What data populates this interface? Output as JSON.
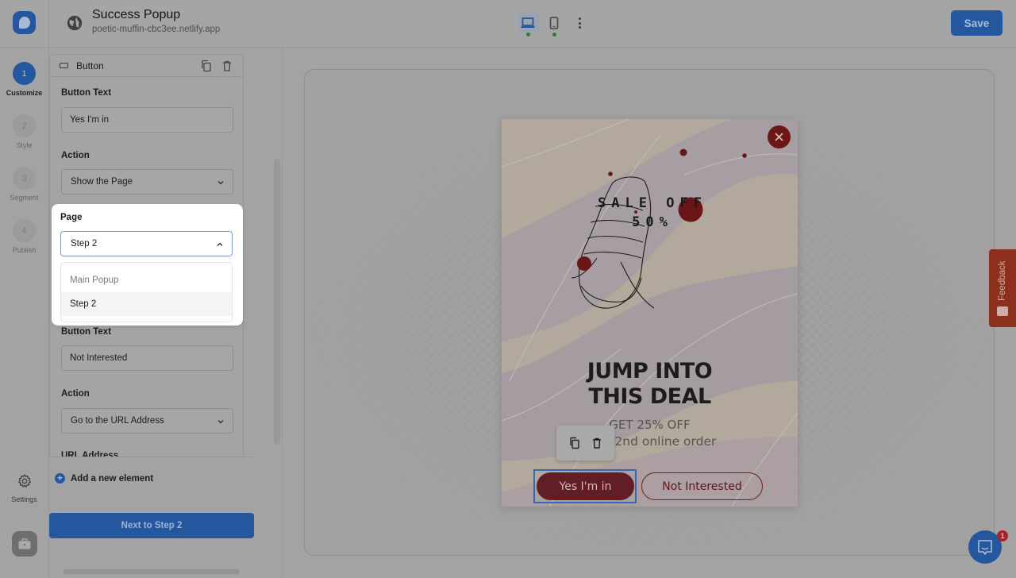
{
  "header": {
    "title": "Success Popup",
    "domain": "poetic-muffin-cbc3ee.netlify.app",
    "save_label": "Save",
    "devices": [
      {
        "name": "desktop",
        "active": true,
        "status": "published"
      },
      {
        "name": "mobile",
        "active": false,
        "status": "published"
      }
    ]
  },
  "steps": [
    {
      "number": "1",
      "label": "Customize",
      "active": true
    },
    {
      "number": "2",
      "label": "Style",
      "active": false
    },
    {
      "number": "3",
      "label": "Segment",
      "active": false
    },
    {
      "number": "4",
      "label": "Publish",
      "active": false
    }
  ],
  "settings_label": "Settings",
  "panel": {
    "header_title": "Button",
    "button1": {
      "text_label": "Button Text",
      "text_value": "Yes I'm in",
      "action_label": "Action",
      "action_value": "Show the Page",
      "page_label": "Page",
      "page_value": "Step 2",
      "page_options": [
        "Main Popup",
        "Step 2"
      ]
    },
    "button2": {
      "text_label": "Button Text",
      "text_value": "Not Interested",
      "action_label": "Action",
      "action_value": "Go to the URL Address",
      "url_label": "URL Address"
    },
    "add_element_label": "Add a new element",
    "next_label": "Next to Step 2"
  },
  "popup": {
    "sale_line1": "SALE OFF",
    "sale_line2": "50%",
    "headline_line1": "JUMP INTO",
    "headline_line2": "THIS DEAL",
    "sub_line1": "GET 25% OFF",
    "sub_line2": "your 2nd online order",
    "yes_button": "Yes I'm in",
    "no_button": "Not Interested",
    "accent_color": "#6e1717"
  },
  "feedback_label": "Feedback",
  "chat_badge_count": "1",
  "colors": {
    "primary": "#25579f",
    "popup_accent": "#631d24"
  }
}
